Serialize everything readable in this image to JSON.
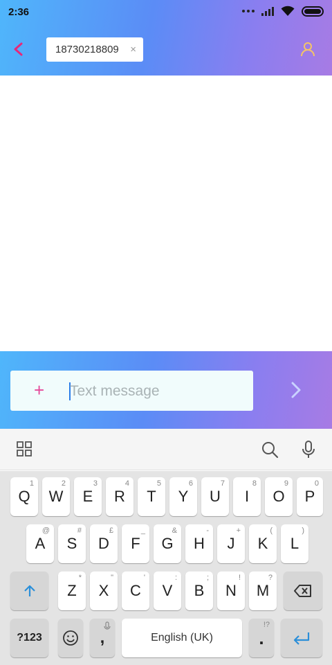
{
  "status_bar": {
    "time": "2:36"
  },
  "header": {
    "recipient": "18730218809",
    "chip_close": "×"
  },
  "compose": {
    "plus": "+",
    "placeholder": "Text message"
  },
  "keyboard": {
    "row1": [
      {
        "label": "Q",
        "hint": "1"
      },
      {
        "label": "W",
        "hint": "2"
      },
      {
        "label": "E",
        "hint": "3"
      },
      {
        "label": "R",
        "hint": "4"
      },
      {
        "label": "T",
        "hint": "5"
      },
      {
        "label": "Y",
        "hint": "6"
      },
      {
        "label": "U",
        "hint": "7"
      },
      {
        "label": "I",
        "hint": "8"
      },
      {
        "label": "O",
        "hint": "9"
      },
      {
        "label": "P",
        "hint": "0"
      }
    ],
    "row2": [
      {
        "label": "A",
        "hint": "@"
      },
      {
        "label": "S",
        "hint": "#"
      },
      {
        "label": "D",
        "hint": "£"
      },
      {
        "label": "F",
        "hint": "_"
      },
      {
        "label": "G",
        "hint": "&"
      },
      {
        "label": "H",
        "hint": "-"
      },
      {
        "label": "J",
        "hint": "+"
      },
      {
        "label": "K",
        "hint": "("
      },
      {
        "label": "L",
        "hint": ")"
      }
    ],
    "row3": [
      {
        "label": "Z",
        "hint": "*"
      },
      {
        "label": "X",
        "hint": "\""
      },
      {
        "label": "C",
        "hint": "'"
      },
      {
        "label": "V",
        "hint": ":"
      },
      {
        "label": "B",
        "hint": ";"
      },
      {
        "label": "N",
        "hint": "!"
      },
      {
        "label": "M",
        "hint": "?"
      }
    ],
    "symbols_label": "?123",
    "comma_label": ",",
    "space_label": "English (UK)",
    "period_label": ".",
    "period_hint": "!?"
  }
}
